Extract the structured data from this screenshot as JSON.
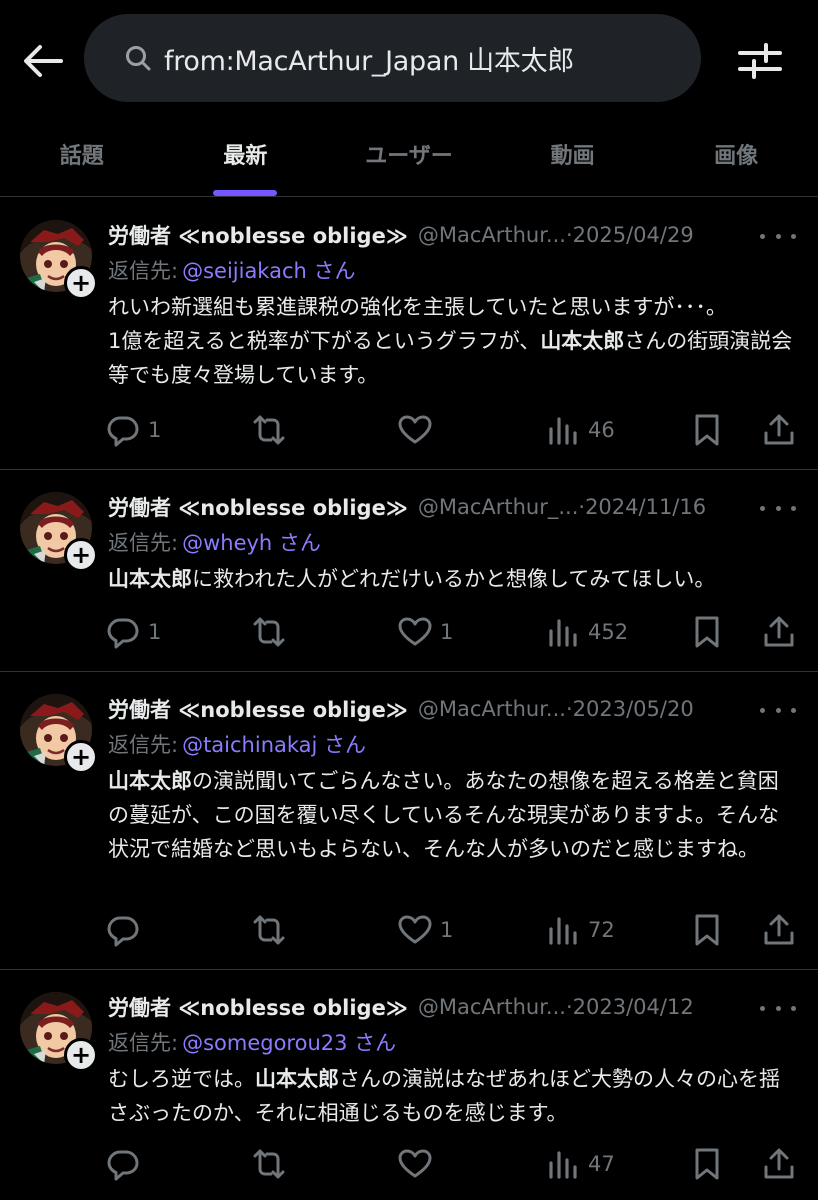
{
  "header": {
    "search_query": "from:MacArthur_Japan 山本太郎",
    "tabs": [
      "話題",
      "最新",
      "ユーザー",
      "動画",
      "画像"
    ],
    "active_tab": "最新"
  },
  "colors": {
    "accent": "#7856ff",
    "link": "#8b7cff",
    "muted": "#71767b",
    "background": "#000000"
  },
  "icons": [
    "back-arrow-icon",
    "search-icon",
    "filter-sliders-icon",
    "more-dots-icon",
    "plus-icon",
    "reply-icon",
    "repost-icon",
    "like-icon",
    "views-icon",
    "bookmark-icon",
    "share-icon"
  ],
  "posts": [
    {
      "display_name": "労働者 ≪noblesse oblige≫",
      "handle": "@MacArthur...",
      "sep": " · ",
      "date": "2025/04/29",
      "reply_prefix": "返信先:",
      "reply_to": "@seijiakach さん",
      "text_segments": [
        {
          "t": "れいわ新選組も累進課税の強化を主張していたと思いますが･･･。\n1億を超えると税率が下がるというグラフが、",
          "b": false
        },
        {
          "t": "山本太郎",
          "b": true
        },
        {
          "t": "さんの街頭演説会等でも度々登場しています。",
          "b": false
        }
      ],
      "replies": "1",
      "reposts": "",
      "likes": "",
      "views": "46"
    },
    {
      "display_name": "労働者 ≪noblesse oblige≫",
      "handle": "@MacArthur_...",
      "sep": " · ",
      "date": "2024/11/16",
      "reply_prefix": "返信先:",
      "reply_to": "@wheyh さん",
      "text_segments": [
        {
          "t": "山本太郎",
          "b": true
        },
        {
          "t": "に救われた人がどれだけいるかと想像してみてほしい。",
          "b": false
        }
      ],
      "replies": "1",
      "reposts": "",
      "likes": "1",
      "views": "452"
    },
    {
      "display_name": "労働者 ≪noblesse oblige≫",
      "handle": "@MacArthur...",
      "sep": " · ",
      "date": "2023/05/20",
      "reply_prefix": "返信先:",
      "reply_to": "@taichinakaj さん",
      "text_segments": [
        {
          "t": "山本太郎",
          "b": true
        },
        {
          "t": "の演説聞いてごらんなさい。あなたの想像を超える格差と貧困の蔓延が、この国を覆い尽くしているそんな現実がありますよ。そんな状況で結婚など思いもよらない、そんな人が多いのだと感じますね。",
          "b": false
        }
      ],
      "replies": "",
      "reposts": "",
      "likes": "1",
      "views": "72"
    },
    {
      "display_name": "労働者 ≪noblesse oblige≫",
      "handle": "@MacArthur...",
      "sep": " · ",
      "date": "2023/04/12",
      "reply_prefix": "返信先:",
      "reply_to": "@somegorou23 さん",
      "text_segments": [
        {
          "t": "むしろ逆では。",
          "b": false
        },
        {
          "t": "山本太郎",
          "b": true
        },
        {
          "t": "さんの演説はなぜあれほど大勢の人々の心を揺さぶったのか、それに相通じるものを感じます。",
          "b": false
        }
      ],
      "replies": "",
      "reposts": "",
      "likes": "",
      "views": "47"
    }
  ]
}
